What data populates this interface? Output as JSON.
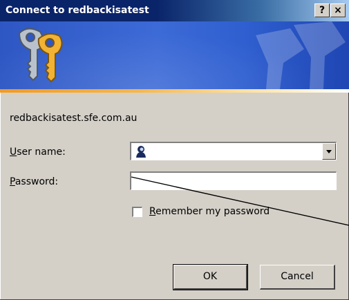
{
  "window": {
    "title": "Connect to redbackisatest",
    "help_button": "?",
    "close_button": "×"
  },
  "banner": {
    "icon": "keys-icon",
    "watermark_icon": "keys-watermark-icon"
  },
  "server": "redbackisatest.sfe.com.au",
  "form": {
    "username": {
      "label_key": "U",
      "label_rest": "ser name:",
      "value": "",
      "icon": "user-icon"
    },
    "password": {
      "label_key": "P",
      "label_rest": "assword:",
      "value": ""
    },
    "remember": {
      "label_key": "R",
      "label_rest": "emember my password",
      "checked": false
    }
  },
  "buttons": {
    "ok": "OK",
    "cancel": "Cancel"
  },
  "colors": {
    "title_bar": "#0a246a",
    "dialog_face": "#d4d0c8",
    "banner": "#2e57c4",
    "accent_strip": "#f49a1f"
  }
}
